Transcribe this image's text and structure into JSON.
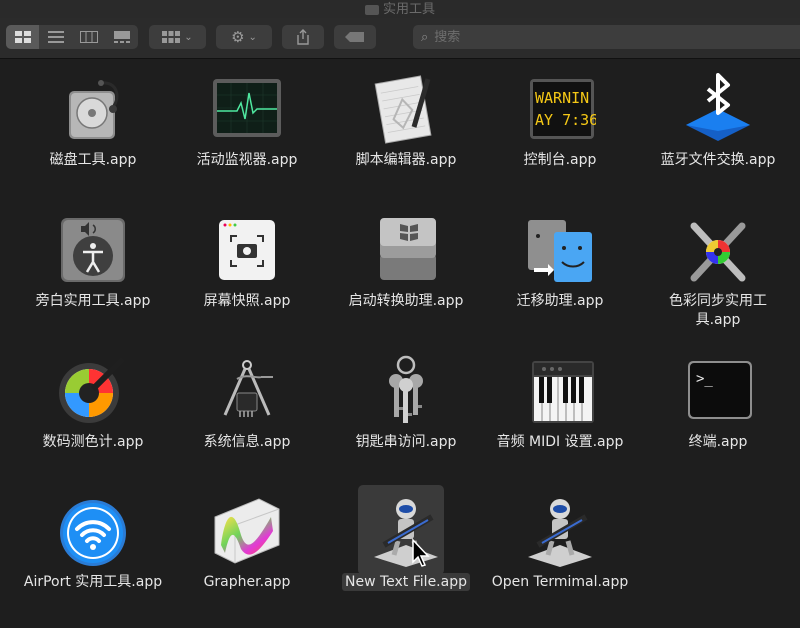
{
  "window": {
    "title": "实用工具"
  },
  "toolbar": {
    "search_placeholder": "搜索",
    "view_icons": [
      "icon-view-icon",
      "list-view-icon",
      "column-view-icon",
      "gallery-view-icon"
    ]
  },
  "items": [
    {
      "label": "磁盘工具.app"
    },
    {
      "label": "活动监视器.app"
    },
    {
      "label": "脚本编辑器.app"
    },
    {
      "label": "控制台.app",
      "console_text": [
        "WARNIN",
        "AY 7:36"
      ]
    },
    {
      "label": "蓝牙文件交换.app"
    },
    {
      "label": "旁白实用工具.app"
    },
    {
      "label": "屏幕快照.app"
    },
    {
      "label": "启动转换助理.app"
    },
    {
      "label": "迁移助理.app"
    },
    {
      "label": "色彩同步实用工具.app"
    },
    {
      "label": "数码测色计.app"
    },
    {
      "label": "系统信息.app"
    },
    {
      "label": "钥匙串访问.app"
    },
    {
      "label": "音频 MIDI 设置.app"
    },
    {
      "label": "终端.app",
      "terminal_prompt": ">_"
    },
    {
      "label": "AirPort 实用工具.app"
    },
    {
      "label": "Grapher.app"
    },
    {
      "label": "New Text File.app"
    },
    {
      "label": "Open Termimal.app"
    }
  ],
  "colors": {
    "background": "#1e1e1e",
    "bluetooth": "#1a7ff0",
    "airport": "#1e8ff5",
    "selection": "#3a3a3a"
  }
}
